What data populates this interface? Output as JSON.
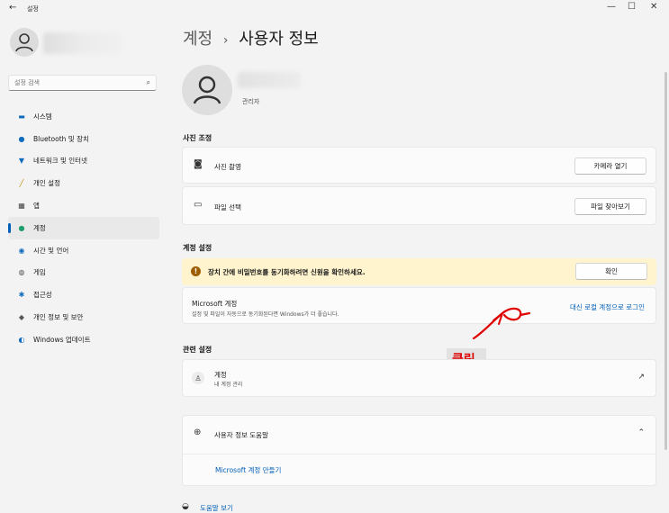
{
  "window": {
    "title": "설정",
    "back": "←",
    "minimize": "—",
    "maximize": "☐",
    "close": "✕"
  },
  "sidebar": {
    "search_placeholder": "설정 검색",
    "items": [
      {
        "label": "시스템",
        "icon": "monitor-icon",
        "color": "#0f6cbd"
      },
      {
        "label": "Bluetooth 및 장치",
        "icon": "bluetooth-icon",
        "color": "#0f6cbd"
      },
      {
        "label": "네트워크 및 인터넷",
        "icon": "wifi-icon",
        "color": "#0f6cbd"
      },
      {
        "label": "개인 설정",
        "icon": "brush-icon",
        "color": "#c48a00"
      },
      {
        "label": "앱",
        "icon": "apps-icon",
        "color": "#444444"
      },
      {
        "label": "계정",
        "icon": "person-icon",
        "color": "#1f9e6d",
        "active": true
      },
      {
        "label": "시간 및 언어",
        "icon": "globe-icon",
        "color": "#0f6cbd"
      },
      {
        "label": "게임",
        "icon": "gamepad-icon",
        "color": "#555555"
      },
      {
        "label": "접근성",
        "icon": "accessibility-icon",
        "color": "#0f6cbd"
      },
      {
        "label": "개인 정보 및 보안",
        "icon": "shield-icon",
        "color": "#555555"
      },
      {
        "label": "Windows 업데이트",
        "icon": "update-icon",
        "color": "#0f6cbd"
      }
    ]
  },
  "breadcrumb": {
    "parent": "계정",
    "separator": "›",
    "current": "사용자 정보"
  },
  "profile": {
    "role": "관리자"
  },
  "photo_section": {
    "heading": "사진 조정",
    "rows": [
      {
        "label": "사진 촬영",
        "button": "카메라 열기"
      },
      {
        "label": "파일 선택",
        "button": "파일 찾아보기"
      }
    ]
  },
  "account_section": {
    "heading": "계정 설정",
    "warning_text": "장치 간에 비밀번호를 동기화하려면 신원을 확인하세요.",
    "warning_button": "확인",
    "ms_title": "Microsoft 계정",
    "ms_sub": "설정 및 파일이 자동으로 동기화된다면 Windows가 더 좋습니다.",
    "ms_link": "대신 로컬 계정으로 로그인"
  },
  "annotation": {
    "text": "클릭",
    "color": "#e00000"
  },
  "related_section": {
    "heading": "관련 설정",
    "account_title": "계정",
    "account_sub": "내 계정 관리"
  },
  "help_section": {
    "title": "사용자 정보 도움말",
    "link": "Microsoft 계정 만들기"
  },
  "footer": {
    "help_link": "도움말 보기"
  },
  "colors": {
    "accent": "#005fb8",
    "warning_bg": "#fff4ce",
    "warning_icon": "#9d5d00"
  }
}
